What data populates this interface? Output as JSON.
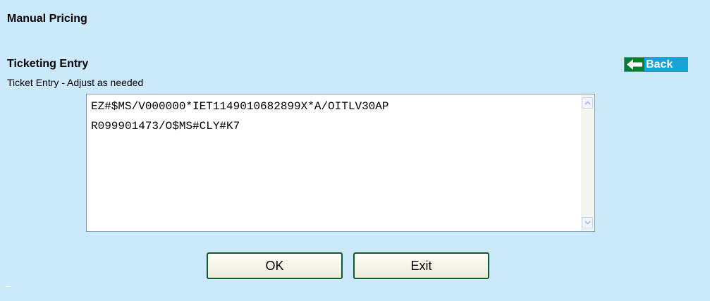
{
  "header": {
    "title": "Manual Pricing"
  },
  "section": {
    "title": "Ticketing Entry",
    "subtitle": "Ticket Entry - Adjust as needed"
  },
  "back_button": {
    "label": "Back",
    "icon": "left-arrow-icon"
  },
  "ticket_entry": {
    "value": "EZ#$MS/V000000*IET1149010682899X*A/OITLV30AP\nR099901473/O$MS#CLY#K7"
  },
  "actions": {
    "ok_label": "OK",
    "exit_label": "Exit"
  },
  "colors": {
    "background": "#cce9fb",
    "back_button": "#1aa3d6",
    "button_border": "#0c5b2b"
  }
}
